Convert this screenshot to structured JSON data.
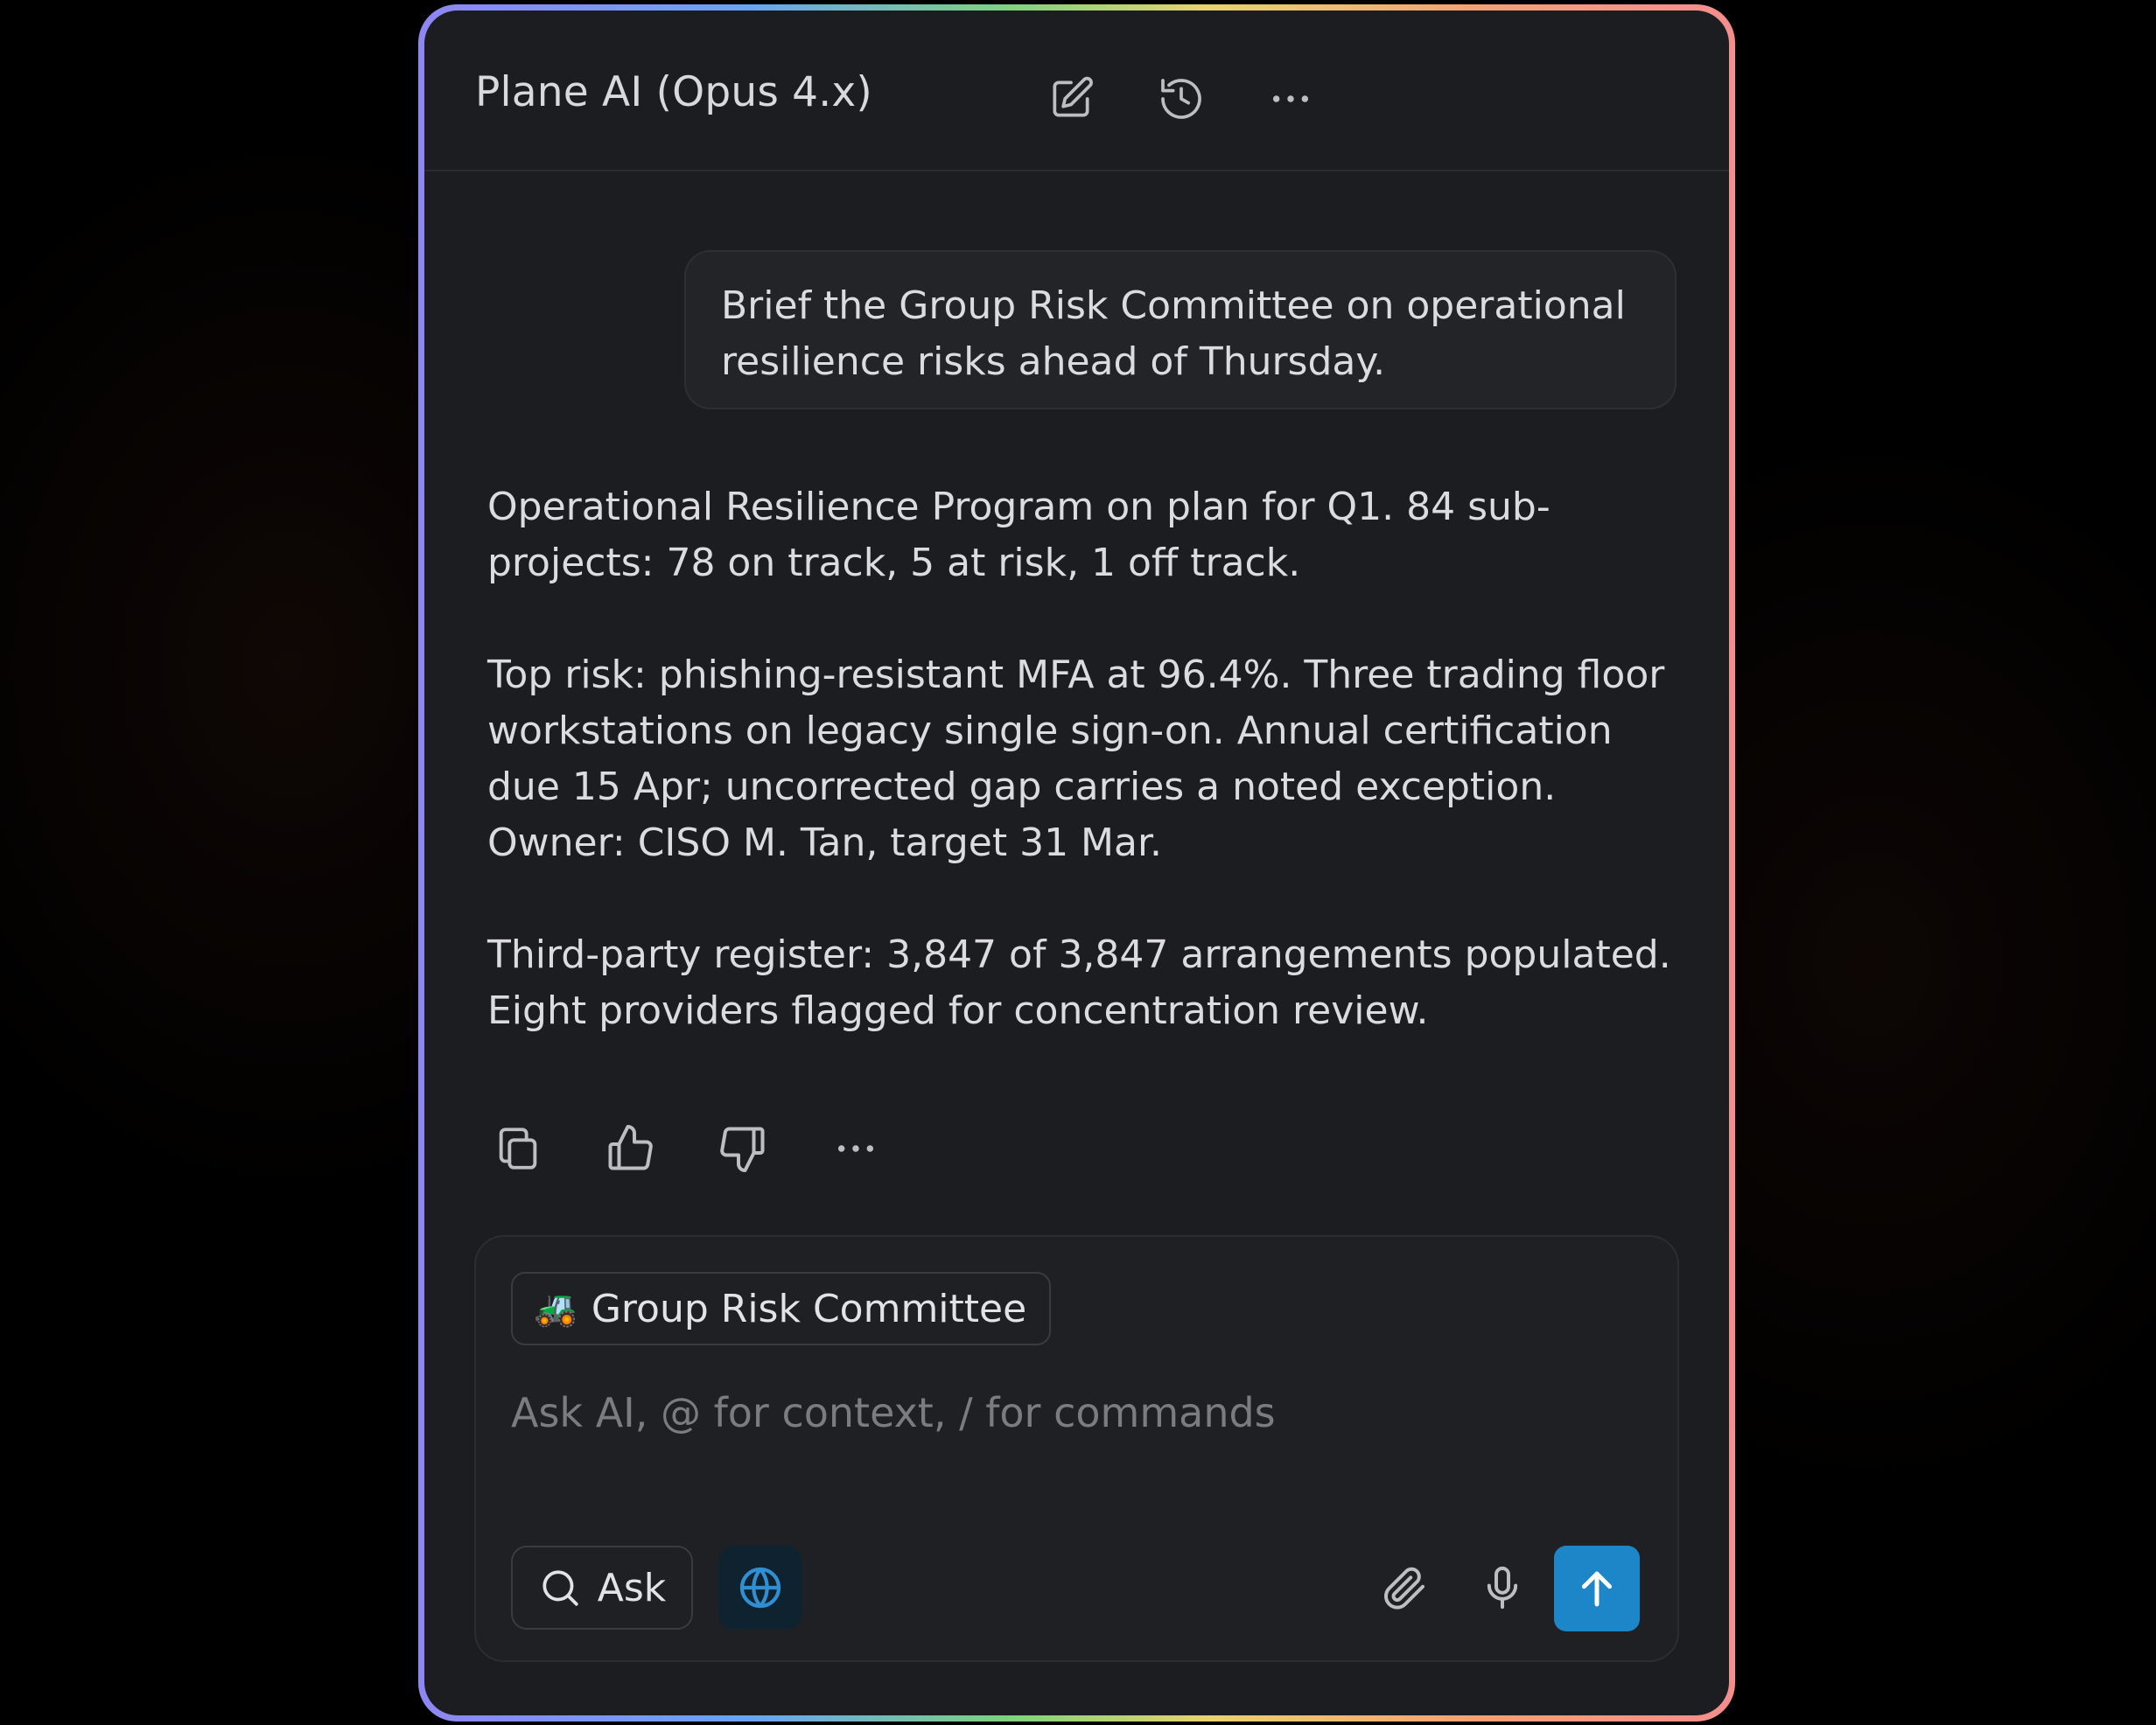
{
  "header": {
    "title": "Plane AI (Opus 4.x)",
    "icons": [
      "new-chat-icon",
      "history-icon",
      "more-icon"
    ]
  },
  "conversation": {
    "user_message": "Brief the Group Risk Committee on operational resilience risks ahead of Thursday.",
    "assistant_paragraphs": [
      "Operational Resilience Program on plan for Q1. 84 sub-projects: 78 on track, 5 at risk, 1 off track.",
      "Top risk: phishing-resistant MFA at 96.4%. Three trading floor workstations on legacy single sign-on. Annual certification due 15 Apr; uncorrected gap carries a noted exception. Owner: CISO M. Tan, target 31 Mar.",
      "Third-party register: 3,847 of 3,847 arrangements populated. Eight providers flagged for concentration review."
    ],
    "message_actions": [
      "copy-icon",
      "thumbs-up-icon",
      "thumbs-down-icon",
      "more-icon"
    ]
  },
  "composer": {
    "context_chip": {
      "emoji": "🚜",
      "label": "Group Risk Committee"
    },
    "placeholder": "Ask AI, @ for context, / for commands",
    "value": "",
    "mode_label": "Ask",
    "accent_color": "#1d86c9",
    "tools": [
      "search-icon",
      "globe-icon",
      "paperclip-icon",
      "microphone-icon",
      "send-arrow-icon"
    ]
  }
}
